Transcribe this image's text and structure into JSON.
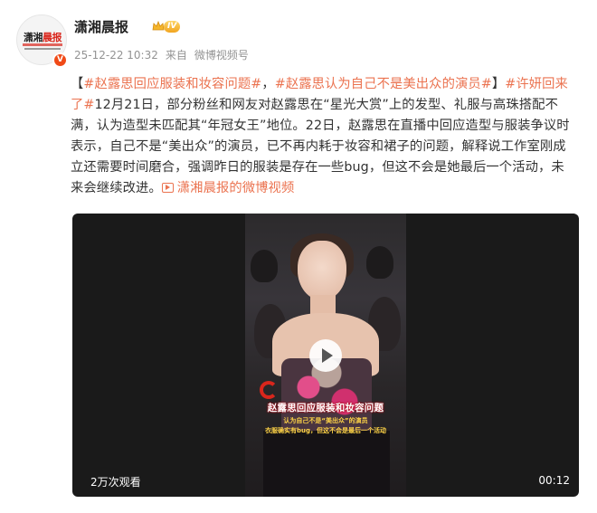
{
  "author": {
    "name": "潇湘晨报",
    "level": "IV",
    "avatar_text_a": "潇湘",
    "avatar_text_b": "晨报",
    "verified_mark": "V"
  },
  "meta": {
    "timestamp": "25-12-22 10:32",
    "source_prefix": "来自",
    "source": "微博视频号"
  },
  "post": {
    "bracket_open": "【",
    "tag1": "#赵露思回应服装和妆容问题#",
    "sep": "，",
    "tag2": "#赵露思认为自己不是美出众的演员#",
    "bracket_close": "】",
    "tag3": "#许妍回来了#",
    "body": "12月21日，部分粉丝和网友对赵露思在“星光大赏”上的发型、礼服与高珠搭配不满，认为造型未匹配其“年冠女王”地位。22日，赵露思在直播中回应造型与服装争议时表示，自己不是“美出众”的演员，已不再内耗于妆容和裙子的问题，解释说工作室刚成立还需要时间磨合，强调昨日的服装是存在一些bug，但这不会是她最后一个活动，未来会继续改进。",
    "video_link": "潇湘晨报的微博视频"
  },
  "video": {
    "views": "2万次观看",
    "duration": "00:12",
    "overlay_title": "赵露思回应服装和妆容问题",
    "overlay_line1": "认为自己不是“美出众”的演员",
    "overlay_line2": "衣服确实有bug，但这不会是最后一个活动"
  },
  "colors": {
    "link": "#eb7350",
    "brand_red": "#d9261c",
    "meta_gray": "#939393"
  }
}
